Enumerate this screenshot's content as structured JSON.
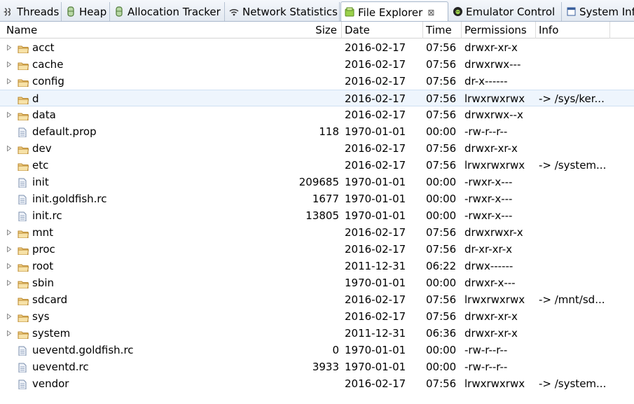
{
  "tabs": [
    {
      "label": "Threads",
      "icon": "threads-icon"
    },
    {
      "label": "Heap",
      "icon": "heap-icon"
    },
    {
      "label": "Allocation Tracker",
      "icon": "allocation-icon"
    },
    {
      "label": "Network Statistics",
      "icon": "network-icon"
    },
    {
      "label": "File Explorer",
      "icon": "file-explorer-icon",
      "active": true,
      "close": "⊠"
    },
    {
      "label": "Emulator Control",
      "icon": "emulator-icon"
    },
    {
      "label": "System Information",
      "icon": "system-info-icon"
    }
  ],
  "columns": {
    "name": "Name",
    "size": "Size",
    "date": "Date",
    "time": "Time",
    "permissions": "Permissions",
    "info": "Info"
  },
  "rows": [
    {
      "name": "acct",
      "type": "folder",
      "expandable": true,
      "size": "",
      "date": "2016-02-17",
      "time": "07:56",
      "perm": "drwxr-xr-x",
      "info": ""
    },
    {
      "name": "cache",
      "type": "folder",
      "expandable": true,
      "size": "",
      "date": "2016-02-17",
      "time": "07:56",
      "perm": "drwxrwx---",
      "info": ""
    },
    {
      "name": "config",
      "type": "folder",
      "expandable": true,
      "size": "",
      "date": "2016-02-17",
      "time": "07:56",
      "perm": "dr-x------",
      "info": ""
    },
    {
      "name": "d",
      "type": "folder",
      "expandable": false,
      "selected": true,
      "size": "",
      "date": "2016-02-17",
      "time": "07:56",
      "perm": "lrwxrwxrwx",
      "info": "-> /sys/ker..."
    },
    {
      "name": "data",
      "type": "folder",
      "expandable": true,
      "size": "",
      "date": "2016-02-17",
      "time": "07:56",
      "perm": "drwxrwx--x",
      "info": ""
    },
    {
      "name": "default.prop",
      "type": "file",
      "expandable": false,
      "size": "118",
      "date": "1970-01-01",
      "time": "00:00",
      "perm": "-rw-r--r--",
      "info": ""
    },
    {
      "name": "dev",
      "type": "folder",
      "expandable": true,
      "size": "",
      "date": "2016-02-17",
      "time": "07:56",
      "perm": "drwxr-xr-x",
      "info": ""
    },
    {
      "name": "etc",
      "type": "folder",
      "expandable": false,
      "size": "",
      "date": "2016-02-17",
      "time": "07:56",
      "perm": "lrwxrwxrwx",
      "info": "-> /system..."
    },
    {
      "name": "init",
      "type": "file",
      "expandable": false,
      "size": "209685",
      "date": "1970-01-01",
      "time": "00:00",
      "perm": "-rwxr-x---",
      "info": ""
    },
    {
      "name": "init.goldfish.rc",
      "type": "file",
      "expandable": false,
      "size": "1677",
      "date": "1970-01-01",
      "time": "00:00",
      "perm": "-rwxr-x---",
      "info": ""
    },
    {
      "name": "init.rc",
      "type": "file",
      "expandable": false,
      "size": "13805",
      "date": "1970-01-01",
      "time": "00:00",
      "perm": "-rwxr-x---",
      "info": ""
    },
    {
      "name": "mnt",
      "type": "folder",
      "expandable": true,
      "size": "",
      "date": "2016-02-17",
      "time": "07:56",
      "perm": "drwxrwxr-x",
      "info": ""
    },
    {
      "name": "proc",
      "type": "folder",
      "expandable": true,
      "size": "",
      "date": "2016-02-17",
      "time": "07:56",
      "perm": "dr-xr-xr-x",
      "info": ""
    },
    {
      "name": "root",
      "type": "folder",
      "expandable": true,
      "size": "",
      "date": "2011-12-31",
      "time": "06:22",
      "perm": "drwx------",
      "info": ""
    },
    {
      "name": "sbin",
      "type": "folder",
      "expandable": true,
      "size": "",
      "date": "1970-01-01",
      "time": "00:00",
      "perm": "drwxr-x---",
      "info": ""
    },
    {
      "name": "sdcard",
      "type": "folder",
      "expandable": false,
      "size": "",
      "date": "2016-02-17",
      "time": "07:56",
      "perm": "lrwxrwxrwx",
      "info": "-> /mnt/sd..."
    },
    {
      "name": "sys",
      "type": "folder",
      "expandable": true,
      "size": "",
      "date": "2016-02-17",
      "time": "07:56",
      "perm": "drwxr-xr-x",
      "info": ""
    },
    {
      "name": "system",
      "type": "folder",
      "expandable": true,
      "size": "",
      "date": "2011-12-31",
      "time": "06:36",
      "perm": "drwxr-xr-x",
      "info": ""
    },
    {
      "name": "ueventd.goldfish.rc",
      "type": "file",
      "expandable": false,
      "size": "0",
      "date": "1970-01-01",
      "time": "00:00",
      "perm": "-rw-r--r--",
      "info": ""
    },
    {
      "name": "ueventd.rc",
      "type": "file",
      "expandable": false,
      "size": "3933",
      "date": "1970-01-01",
      "time": "00:00",
      "perm": "-rw-r--r--",
      "info": ""
    },
    {
      "name": "vendor",
      "type": "file",
      "expandable": false,
      "size": "",
      "date": "2016-02-17",
      "time": "07:56",
      "perm": "lrwxrwxrwx",
      "info": "-> /system..."
    }
  ]
}
